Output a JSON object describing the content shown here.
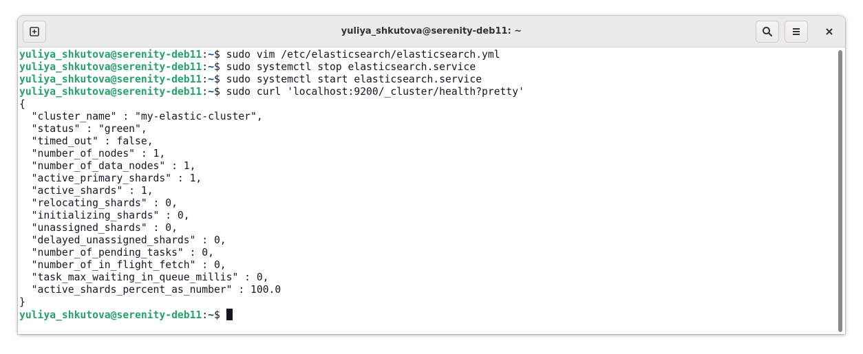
{
  "window": {
    "title": "yuliya_shkutova@serenity-deb11: ~"
  },
  "headerbar": {
    "new_tab_icon": "new-tab-icon",
    "search_icon": "search-icon",
    "menu_icon": "hamburger-menu-icon",
    "close_icon": "close-icon"
  },
  "terminal": {
    "prompt_user": "yuliya_shkutova@serenity-deb11",
    "prompt_sep": ":",
    "prompt_path": "~",
    "prompt_sigil": "$ ",
    "commands": [
      "sudo vim /etc/elasticsearch/elasticsearch.yml",
      "sudo systemctl stop elasticsearch.service",
      "sudo systemctl start elasticsearch.service",
      "sudo curl 'localhost:9200/_cluster/health?pretty'"
    ],
    "output": [
      "{",
      "  \"cluster_name\" : \"my-elastic-cluster\",",
      "  \"status\" : \"green\",",
      "  \"timed_out\" : false,",
      "  \"number_of_nodes\" : 1,",
      "  \"number_of_data_nodes\" : 1,",
      "  \"active_primary_shards\" : 1,",
      "  \"active_shards\" : 1,",
      "  \"relocating_shards\" : 0,",
      "  \"initializing_shards\" : 0,",
      "  \"unassigned_shards\" : 0,",
      "  \"delayed_unassigned_shards\" : 0,",
      "  \"number_of_pending_tasks\" : 0,",
      "  \"number_of_in_flight_fetch\" : 0,",
      "  \"task_max_waiting_in_queue_millis\" : 0,",
      "  \"active_shards_percent_as_number\" : 100.0",
      "}"
    ]
  },
  "colors": {
    "prompt_user": "#26a269",
    "prompt_path": "#12488b",
    "text": "#171421",
    "background": "#ffffff",
    "headerbar": "#ebebeb"
  }
}
